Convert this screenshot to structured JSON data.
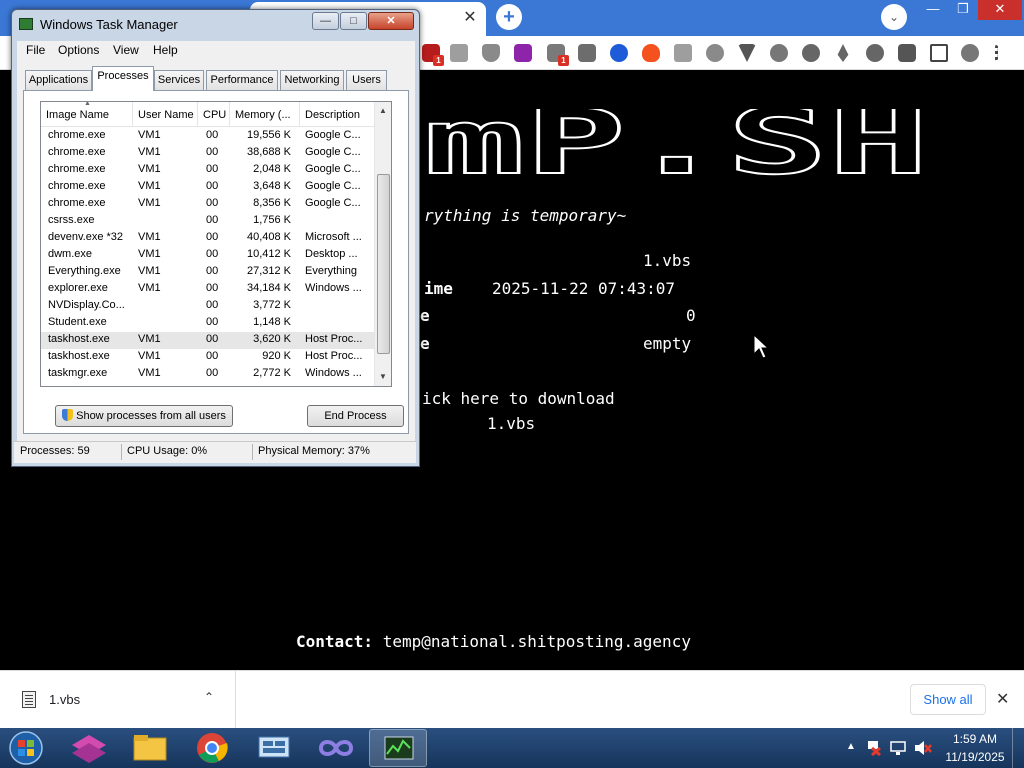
{
  "chrome": {
    "tab_close": "✕",
    "new_tab": "+",
    "tab_search": "⌄",
    "minimize": "—",
    "maximize": "❐",
    "close": "✕",
    "extension_badges": [
      "1",
      "1"
    ]
  },
  "page": {
    "logo_text": "mP.SH",
    "tagline": "rything is temporary~",
    "file_value": "1.vbs",
    "time_label": "ime",
    "time_value": "2025-11-22 07:43:07",
    "row3_label": "e",
    "row3_value": "0",
    "row4_label": "e",
    "row4_value": "empty",
    "download_link": "ick here to download",
    "download_file": "1.vbs",
    "contact_label": "Contact:",
    "contact_email": "temp@national.shitposting.agency"
  },
  "download_bar": {
    "file_name": "1.vbs",
    "chevron": "⌃",
    "show_all": "Show all",
    "close": "✕"
  },
  "taskbar": {
    "clock_time": "1:59 AM",
    "clock_date": "11/19/2025"
  },
  "task_manager": {
    "title": "Windows Task Manager",
    "min": "—",
    "max": "□",
    "close": "✕",
    "menu": [
      "File",
      "Options",
      "View",
      "Help"
    ],
    "tabs": [
      "Applications",
      "Processes",
      "Services",
      "Performance",
      "Networking",
      "Users"
    ],
    "active_tab": "Processes",
    "columns": [
      "Image Name",
      "User Name",
      "CPU",
      "Memory (...",
      "Description"
    ],
    "rows": [
      [
        "chrome.exe",
        "VM1",
        "00",
        "19,556 K",
        "Google C..."
      ],
      [
        "chrome.exe",
        "VM1",
        "00",
        "38,688 K",
        "Google C..."
      ],
      [
        "chrome.exe",
        "VM1",
        "00",
        "2,048 K",
        "Google C..."
      ],
      [
        "chrome.exe",
        "VM1",
        "00",
        "3,648 K",
        "Google C..."
      ],
      [
        "chrome.exe",
        "VM1",
        "00",
        "8,356 K",
        "Google C..."
      ],
      [
        "csrss.exe",
        "",
        "00",
        "1,756 K",
        ""
      ],
      [
        "devenv.exe *32",
        "VM1",
        "00",
        "40,408 K",
        "Microsoft ..."
      ],
      [
        "dwm.exe",
        "VM1",
        "00",
        "10,412 K",
        "Desktop ..."
      ],
      [
        "Everything.exe",
        "VM1",
        "00",
        "27,312 K",
        "Everything"
      ],
      [
        "explorer.exe",
        "VM1",
        "00",
        "34,184 K",
        "Windows ..."
      ],
      [
        "NVDisplay.Co...",
        "",
        "00",
        "3,772 K",
        ""
      ],
      [
        "Student.exe",
        "",
        "00",
        "1,148 K",
        ""
      ],
      [
        "taskhost.exe",
        "VM1",
        "00",
        "3,620 K",
        "Host Proc..."
      ],
      [
        "taskhost.exe",
        "VM1",
        "00",
        "920 K",
        "Host Proc..."
      ],
      [
        "taskmgr.exe",
        "VM1",
        "00",
        "2,772 K",
        "Windows ..."
      ]
    ],
    "selected_row": 12,
    "show_all_button": "Show processes from all users",
    "end_button": "End Process",
    "status_processes": "Processes: 59",
    "status_cpu": "CPU Usage: 0%",
    "status_memory": "Physical Memory: 37%"
  },
  "colors": {
    "chrome_frame": "#3b78d6",
    "page_bg": "#000000",
    "link_blue": "#1a73e8"
  }
}
